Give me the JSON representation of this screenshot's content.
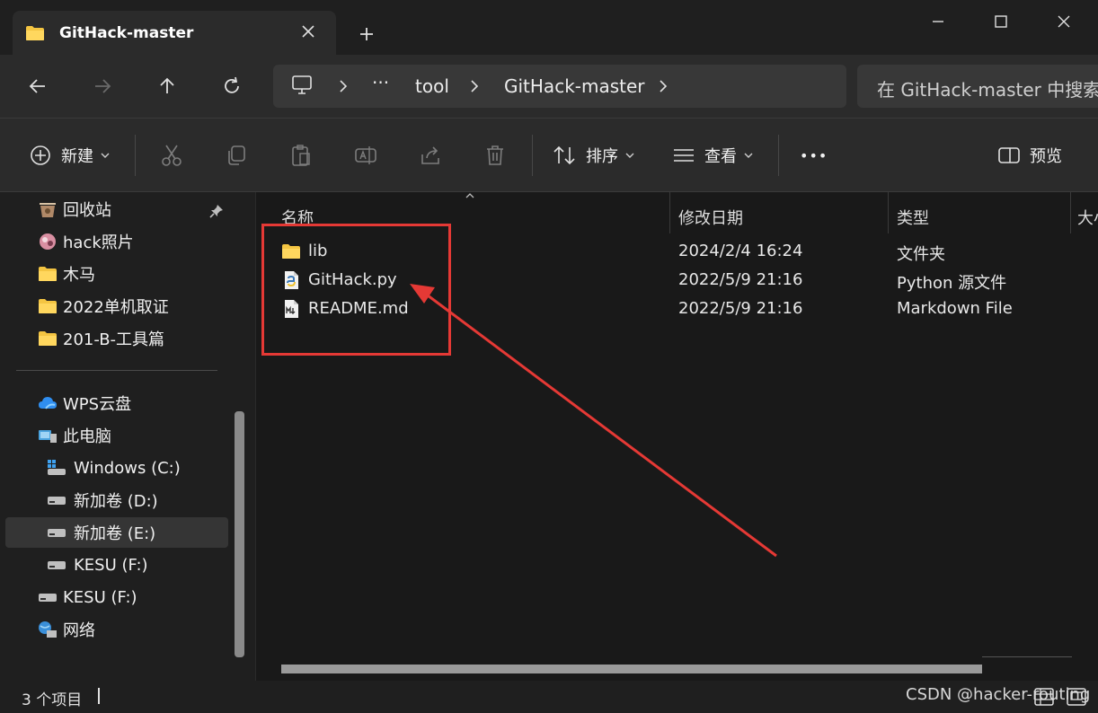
{
  "tab": {
    "title": "GitHack-master",
    "icon": "folder-icon"
  },
  "address": {
    "crumbs": [
      "tool",
      "GitHack-master"
    ],
    "overflow": "···",
    "search_placeholder": "在 GitHack-master 中搜索"
  },
  "toolbar": {
    "new_label": "新建",
    "sort_label": "排序",
    "view_label": "查看",
    "more": "•••",
    "preview_label": "预览"
  },
  "sidebar": {
    "pinned": [
      {
        "label": "回收站",
        "icon": "recycle-bin-icon"
      },
      {
        "label": "hack照片",
        "icon": "photo-folder-icon"
      },
      {
        "label": "木马",
        "icon": "folder-icon"
      },
      {
        "label": "2022单机取证",
        "icon": "folder-icon"
      },
      {
        "label": "201-B-工具篇",
        "icon": "folder-icon"
      }
    ],
    "locations": [
      {
        "label": "WPS云盘",
        "icon": "cloud-icon"
      },
      {
        "label": "此电脑",
        "icon": "computer-icon"
      },
      {
        "label": "Windows  (C:)",
        "icon": "windows-drive-icon"
      },
      {
        "label": "新加卷 (D:)",
        "icon": "drive-icon"
      },
      {
        "label": "新加卷 (E:)",
        "icon": "drive-icon",
        "selected": true
      },
      {
        "label": "KESU (F:)",
        "icon": "drive-icon"
      },
      {
        "label": "KESU (F:)",
        "icon": "drive-icon"
      },
      {
        "label": "网络",
        "icon": "network-icon"
      }
    ]
  },
  "columns": [
    "名称",
    "修改日期",
    "类型",
    "大小"
  ],
  "files": [
    {
      "name": "lib",
      "modified": "2024/2/4 16:24",
      "type": "文件夹",
      "icon": "folder-icon"
    },
    {
      "name": "GitHack.py",
      "modified": "2022/5/9 21:16",
      "type": "Python 源文件",
      "icon": "python-file-icon"
    },
    {
      "name": "README.md",
      "modified": "2022/5/9 21:16",
      "type": "Markdown File",
      "icon": "markdown-file-icon"
    }
  ],
  "status": {
    "item_count": "3 个项目",
    "watermark": "CSDN @hacker-routing"
  },
  "colors": {
    "annotation_red": "#e53935",
    "folder_yellow": "#f4c542",
    "background": "#1c1c1c"
  }
}
